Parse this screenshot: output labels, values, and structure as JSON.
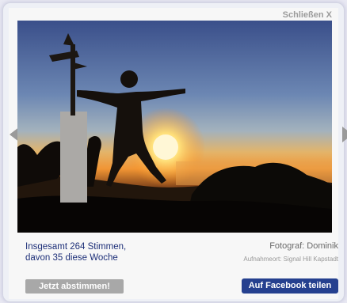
{
  "dialog": {
    "close_label": "Schließen X"
  },
  "photo": {
    "description": "Person mit ausgebreiteten Armen vor Sonnenuntergang neben einem Wegweiser"
  },
  "info": {
    "votes_line1": "Insgesamt 264 Stimmen,",
    "votes_line2": "davon 35 diese Woche",
    "photographer": "Fotograf: Dominik",
    "location": "Aufnahmeort: Signal Hill Kapstadt"
  },
  "actions": {
    "vote_label": "Jetzt abstimmen!",
    "facebook_label": "Auf Facebook teilen"
  },
  "colors": {
    "accent": "#25408f",
    "vote_button": "#a8a8a8"
  }
}
